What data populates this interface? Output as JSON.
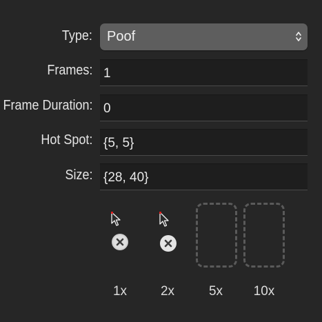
{
  "form": {
    "type_label": "Type:",
    "type_value": "Poof",
    "frames_label": "Frames:",
    "frames_value": "1",
    "frame_duration_label": "Frame Duration:",
    "frame_duration_value": "0",
    "hot_spot_label": "Hot Spot:",
    "hot_spot_value": "{5, 5}",
    "size_label": "Size:",
    "size_value": "{28, 40}"
  },
  "previews": [
    {
      "label": "1x",
      "state": "image",
      "icon": "poof-cursor-icon"
    },
    {
      "label": "2x",
      "state": "image",
      "icon": "poof-cursor-icon"
    },
    {
      "label": "5x",
      "state": "empty"
    },
    {
      "label": "10x",
      "state": "empty"
    }
  ],
  "colors": {
    "background": "#262626",
    "field": "#1e1e1e",
    "popup": "#5e5e5e",
    "hotspot": "#e02020"
  }
}
